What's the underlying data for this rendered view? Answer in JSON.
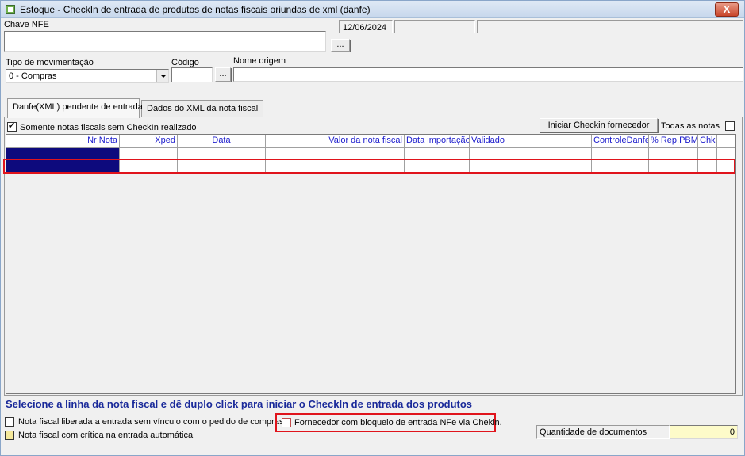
{
  "window": {
    "title": "Estoque - CheckIn de entrada de produtos de notas fiscais oriundas de xml (danfe)",
    "close_label": "X"
  },
  "header": {
    "chave_label": "Chave NFE",
    "chave_value": "",
    "date_value": "12/06/2024",
    "browse_label": "...",
    "status_box_1": "",
    "status_box_2": ""
  },
  "movimento": {
    "tipo_label": "Tipo de movimentação",
    "tipo_value": "0 - Compras",
    "codigo_label": "Código",
    "codigo_value": "",
    "codigo_browse_label": "...",
    "nome_origem_label": "Nome origem",
    "nome_origem_value": ""
  },
  "tabs": [
    {
      "label": "Danfe(XML) pendente de entrada",
      "active": true
    },
    {
      "label": "Dados do XML da nota fiscal",
      "active": false
    }
  ],
  "filters": {
    "somente_label": "Somente notas fiscais sem CheckIn realizado",
    "somente_checked": true,
    "iniciar_button": "Iniciar Checkin fornecedor",
    "todas_label": "Todas as notas",
    "todas_checked": false
  },
  "grid": {
    "columns": [
      {
        "label": "Nr Nota",
        "align": "right"
      },
      {
        "label": "Xped",
        "align": "right"
      },
      {
        "label": "Data",
        "align": "center"
      },
      {
        "label": "Valor da nota fiscal",
        "align": "right"
      },
      {
        "label": "Data importação",
        "align": "left"
      },
      {
        "label": "Validado",
        "align": "left"
      },
      {
        "label": "ControleDanfe",
        "align": "right"
      },
      {
        "label": "% Rep.PBM",
        "align": "left"
      },
      {
        "label": "Chk.",
        "align": "left"
      },
      {
        "label": "",
        "align": "left"
      }
    ],
    "rows": [
      [
        "",
        "",
        "",
        "",
        "",
        "",
        "",
        "",
        "",
        ""
      ]
    ]
  },
  "footer": {
    "instruction": "Selecione a linha da nota fiscal  e dê duplo click para iniciar o CheckIn de entrada dos produtos",
    "legend": [
      {
        "label": "Nota fiscal liberada a entrada sem vínculo com o pedido de compras",
        "color": "#ffffff"
      },
      {
        "label": "Nota fiscal com crítica na entrada automática",
        "color": "#f5e89a"
      },
      {
        "label": "Fornecedor com bloqueio de entrada NFe via Chekin.",
        "color": "#ffffff"
      }
    ],
    "quantidade_label": "Quantidade de documentos",
    "quantidade_value": "0"
  },
  "colors": {
    "selected_cell": "#0d0a7d",
    "header_text": "#1a1acc",
    "highlight_red": "#e0141c",
    "message_blue": "#1a2a9a",
    "quantity_bg": "#fdfbc9"
  }
}
